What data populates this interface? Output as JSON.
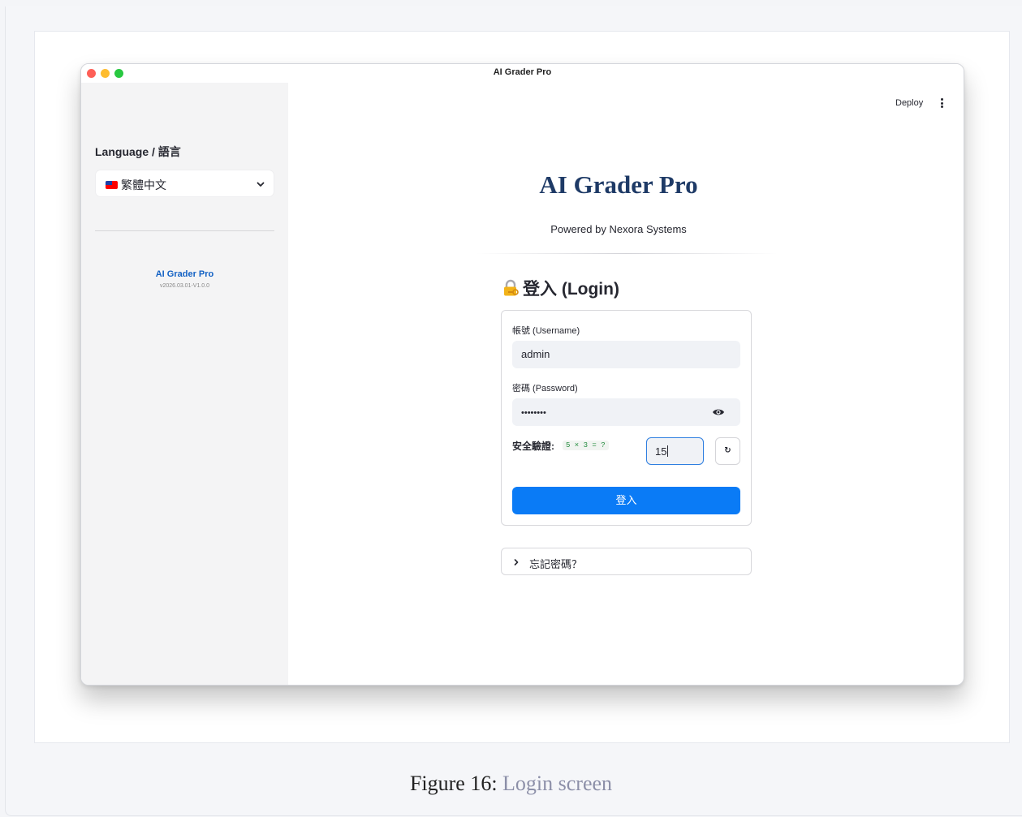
{
  "window": {
    "title": "AI Grader Pro"
  },
  "sidebar": {
    "language_label": "Language / 語言",
    "language_select": {
      "flag": "taiwan-flag-icon",
      "value": "繁體中文"
    },
    "app_name": "AI Grader Pro",
    "version": "v2026.03.01-V1.0.0"
  },
  "toolbar": {
    "deploy_label": "Deploy"
  },
  "main": {
    "title": "AI Grader Pro",
    "subtitle": "Powered by Nexora Systems",
    "login_heading": "登入 (Login)"
  },
  "form": {
    "username_label": "帳號 (Username)",
    "username_value": "admin",
    "password_label": "密碼 (Password)",
    "password_value": "••••••••",
    "captcha_label": "安全驗證:",
    "captcha_question": "5 × 3 = ?",
    "captcha_answer": "15",
    "refresh_label": "↻",
    "submit_label": "登入"
  },
  "forgot": {
    "label": "忘記密碼？"
  },
  "caption": {
    "prefix": "Figure 16:",
    "text": "Login screen"
  },
  "colors": {
    "accent": "#0a7bf6",
    "title": "#1e3a66",
    "link": "#1261c4"
  }
}
